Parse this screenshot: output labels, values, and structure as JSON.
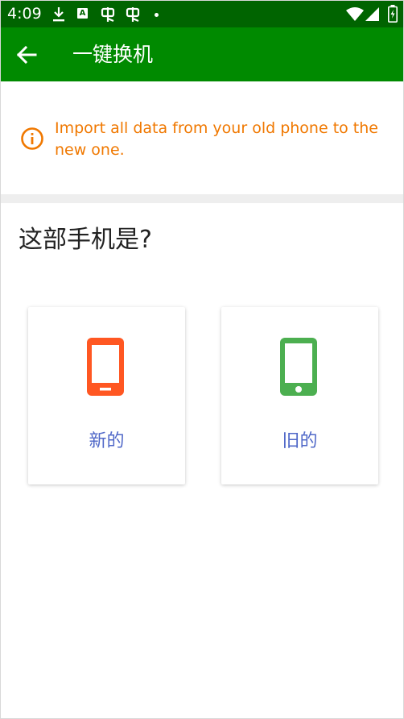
{
  "status_bar": {
    "time": "4:09",
    "icons": [
      "download-icon",
      "translate-a-icon",
      "bug-icon",
      "bug-icon",
      "dot-icon",
      "wifi-icon",
      "signal-icon",
      "battery-icon"
    ]
  },
  "app_bar": {
    "title": "一键换机",
    "back_icon": "arrow-left-icon",
    "background": "#008a00"
  },
  "info_banner": {
    "icon": "info-circle-icon",
    "text": "Import all data from your old phone to the new one.",
    "color": "#f07800"
  },
  "question": "这部手机是?",
  "options": [
    {
      "label": "新的",
      "icon": "phone-icon",
      "color": "#ff5722"
    },
    {
      "label": "旧的",
      "icon": "phone-icon",
      "color": "#4caf50"
    }
  ],
  "colors": {
    "status_bar": "#006400",
    "option_label": "#5068c8"
  }
}
